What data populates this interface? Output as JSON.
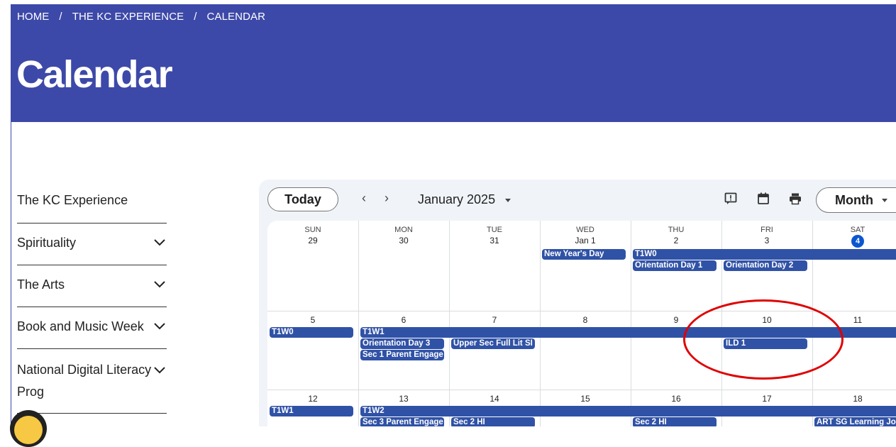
{
  "breadcrumb": [
    "HOME",
    "THE KC EXPERIENCE",
    "CALENDAR"
  ],
  "breadcrumb_separator": "/",
  "page_title": "Calendar",
  "colors": {
    "header_bg": "#3d49a8",
    "event": "#3052a6",
    "today_badge": "#0b57d0",
    "annotation": "#e00000"
  },
  "sidebar": [
    {
      "label": "The KC Experience",
      "expandable": false
    },
    {
      "label": "Spirituality",
      "expandable": true
    },
    {
      "label": "The Arts",
      "expandable": true
    },
    {
      "label": "Book and Music Week",
      "expandable": true
    },
    {
      "label": "National Digital Literacy Prog",
      "expandable": true
    }
  ],
  "calendar": {
    "today_label": "Today",
    "prev_icon": "‹",
    "next_icon": "›",
    "month_label": "January 2025",
    "view_label": "Month",
    "toolbar_icons": [
      "feedback-icon",
      "calendar-icon",
      "print-icon"
    ],
    "day_names": [
      "SUN",
      "MON",
      "TUE",
      "WED",
      "THU",
      "FRI",
      "SAT"
    ],
    "weeks": [
      {
        "days": [
          "29",
          "30",
          "31",
          "Jan 1",
          "2",
          "3",
          "4"
        ],
        "today_index": 6
      },
      {
        "days": [
          "5",
          "6",
          "7",
          "8",
          "9",
          "10",
          "11"
        ]
      },
      {
        "days": [
          "12",
          "13",
          "14",
          "15",
          "16",
          "17",
          "18"
        ]
      }
    ],
    "events": [
      {
        "label": "New Year's Day",
        "week": 0,
        "col": 3,
        "span": 1,
        "row": 0
      },
      {
        "label": "T1W0",
        "week": 0,
        "col": 4,
        "span": 3,
        "row": 0,
        "continues": true
      },
      {
        "label": "Orientation Day 1",
        "week": 0,
        "col": 4,
        "span": 1,
        "row": 1
      },
      {
        "label": "Orientation Day 2",
        "week": 0,
        "col": 5,
        "span": 1,
        "row": 1
      },
      {
        "label": "T1W0",
        "week": 1,
        "col": 0,
        "span": 1,
        "row": 0
      },
      {
        "label": "T1W1",
        "week": 1,
        "col": 1,
        "span": 6,
        "row": 0,
        "continues": true
      },
      {
        "label": "Orientation Day 3",
        "week": 1,
        "col": 1,
        "span": 1,
        "row": 1
      },
      {
        "label": "Upper Sec Full Lit SI",
        "week": 1,
        "col": 2,
        "span": 1,
        "row": 1
      },
      {
        "label": "ILD 1",
        "week": 1,
        "col": 5,
        "span": 1,
        "row": 1
      },
      {
        "label": "Sec 1 Parent Engage",
        "week": 1,
        "col": 1,
        "span": 1,
        "row": 2
      },
      {
        "label": "T1W1",
        "week": 2,
        "col": 0,
        "span": 1,
        "row": 0
      },
      {
        "label": "T1W2",
        "week": 2,
        "col": 1,
        "span": 6,
        "row": 0,
        "continues": true
      },
      {
        "label": "Sec 3 Parent Engage",
        "week": 2,
        "col": 1,
        "span": 1,
        "row": 1
      },
      {
        "label": "Sec 2 HI",
        "week": 2,
        "col": 2,
        "span": 1,
        "row": 1
      },
      {
        "label": "Sec 2 HI",
        "week": 2,
        "col": 4,
        "span": 1,
        "row": 1
      },
      {
        "label": "ART SG Learning Jo",
        "week": 2,
        "col": 6,
        "span": 1,
        "row": 1
      }
    ]
  }
}
